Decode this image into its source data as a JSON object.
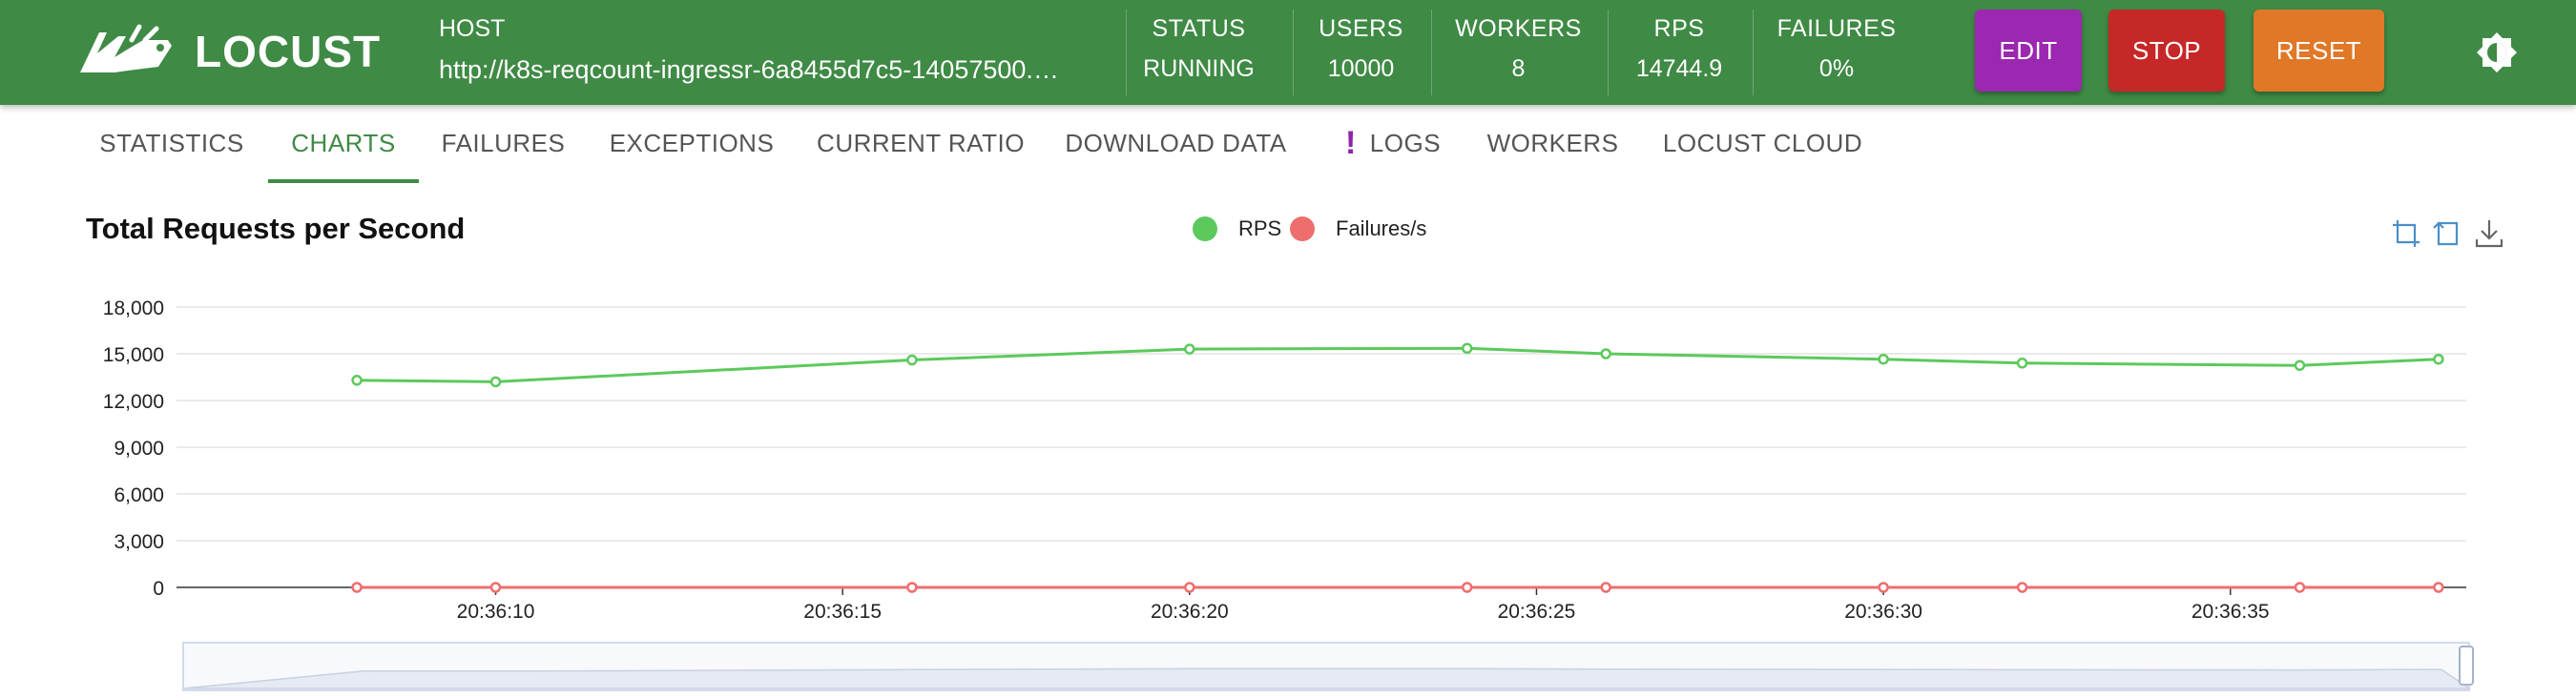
{
  "app": {
    "name": "LOCUST"
  },
  "header": {
    "host": {
      "label": "HOST",
      "value": "http://k8s-reqcount-ingressr-6a8455d7c5-14057500.…"
    },
    "stats": [
      {
        "label": "STATUS",
        "value": "RUNNING"
      },
      {
        "label": "USERS",
        "value": "10000"
      },
      {
        "label": "WORKERS",
        "value": "8"
      },
      {
        "label": "RPS",
        "value": "14744.9"
      },
      {
        "label": "FAILURES",
        "value": "0%"
      }
    ],
    "buttons": {
      "edit": "EDIT",
      "stop": "STOP",
      "reset": "RESET"
    }
  },
  "tabs": [
    {
      "label": "STATISTICS",
      "active": false
    },
    {
      "label": "CHARTS",
      "active": true
    },
    {
      "label": "FAILURES",
      "active": false
    },
    {
      "label": "EXCEPTIONS",
      "active": false
    },
    {
      "label": "CURRENT RATIO",
      "active": false
    },
    {
      "label": "DOWNLOAD DATA",
      "active": false
    },
    {
      "label": "LOGS",
      "active": false,
      "icon": "exclamation-icon"
    },
    {
      "label": "WORKERS",
      "active": false
    },
    {
      "label": "LOCUST CLOUD",
      "active": false
    }
  ],
  "colors": {
    "header_bg": "#3f8a45",
    "edit": "#9c27b0",
    "stop": "#c62828",
    "reset": "#e07828",
    "rps": "#5cc95c",
    "failures": "#ee6e6e",
    "logs_icon": "#8e24aa"
  },
  "toolbox": {
    "icons": [
      "zoom-icon",
      "zoom-reset-icon",
      "download-icon"
    ]
  },
  "chart_data": {
    "type": "line",
    "title": "Total Requests per Second",
    "xlabel": "",
    "ylabel": "",
    "ylim": [
      0,
      18000
    ],
    "y_ticks": [
      "0",
      "3,000",
      "6,000",
      "9,000",
      "12,000",
      "15,000",
      "18,000"
    ],
    "x_tick_labels": [
      "20:36:10",
      "20:36:15",
      "20:36:20",
      "20:36:25",
      "20:36:30",
      "20:36:35"
    ],
    "grid": true,
    "legend_position": "top-center",
    "series": [
      {
        "name": "RPS",
        "x": [
          "20:36:08",
          "20:36:10",
          "20:36:16",
          "20:36:20",
          "20:36:24",
          "20:36:26",
          "20:36:30",
          "20:36:32",
          "20:36:36",
          "20:36:38"
        ],
        "values": [
          13300,
          13200,
          14600,
          15300,
          15350,
          15000,
          14650,
          14400,
          14250,
          14650
        ]
      },
      {
        "name": "Failures/s",
        "x": [
          "20:36:08",
          "20:36:10",
          "20:36:16",
          "20:36:20",
          "20:36:24",
          "20:36:26",
          "20:36:30",
          "20:36:32",
          "20:36:36",
          "20:36:38"
        ],
        "values": [
          0,
          0,
          0,
          0,
          0,
          0,
          0,
          0,
          0,
          0
        ]
      }
    ]
  }
}
